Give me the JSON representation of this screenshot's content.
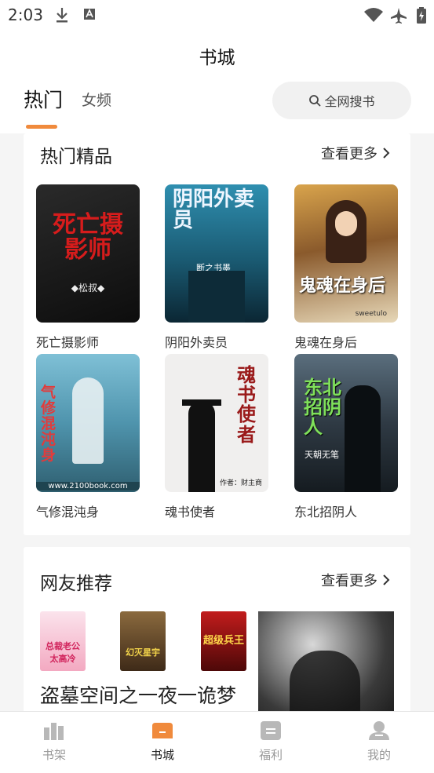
{
  "status_bar": {
    "time": "2:03"
  },
  "header": {
    "title": "书城",
    "tabs": [
      {
        "label": "热门"
      },
      {
        "label": "女频"
      }
    ],
    "search_label": "全网搜书"
  },
  "sections": {
    "hot": {
      "title": "热门精品",
      "more": "查看更多",
      "books": [
        {
          "name": "死亡摄影师",
          "cover_text": "死亡摄影师",
          "cover_sub": "◆松叔◆",
          "bg": "#1a1a1a",
          "accent": "#d61c1c"
        },
        {
          "name": "阴阳外卖员",
          "cover_text": "阴阳外卖员",
          "cover_sub": "断之书墨",
          "bg": "#1f6e8a",
          "accent": "#e9f4ff"
        },
        {
          "name": "鬼魂在身后",
          "cover_text": "鬼魂在身后",
          "cover_sub": "sweetulo",
          "bg": "#b5823a",
          "accent": "#ffffff"
        },
        {
          "name": "气修混沌身",
          "cover_text": "气修混沌身",
          "cover_sub": "www.2100book.com",
          "bg": "#5aa0b8",
          "accent": "#e23b3b"
        },
        {
          "name": "魂书使者",
          "cover_text": "魂书使者",
          "cover_sub": "作者：财主商",
          "bg": "#f0efee",
          "accent": "#9a1a1a"
        },
        {
          "name": "东北招阴人",
          "cover_text": "东北招阴人",
          "cover_sub": "天朝无笔",
          "bg": "#2f3a44",
          "accent": "#7fe05a"
        }
      ]
    },
    "recommend": {
      "title": "网友推荐",
      "more": "查看更多",
      "covers": [
        {
          "cover_text": "总裁老公太高冷",
          "bg": "#f3c6d4",
          "accent": "#d1245c"
        },
        {
          "cover_text": "幻灭星宇",
          "bg": "#6a4a2a",
          "accent": "#f2d34a"
        },
        {
          "cover_text": "超级兵王",
          "bg": "#a31515",
          "accent": "#ffd84a"
        }
      ],
      "featured_title": "盗墓空间之一夜一诡梦"
    }
  },
  "bottom_nav": [
    {
      "label": "书架",
      "active": false
    },
    {
      "label": "书城",
      "active": true
    },
    {
      "label": "福利",
      "active": false
    },
    {
      "label": "我的",
      "active": false
    }
  ],
  "colors": {
    "accent": "#f08a3c",
    "inactive": "#b8b8b8"
  }
}
